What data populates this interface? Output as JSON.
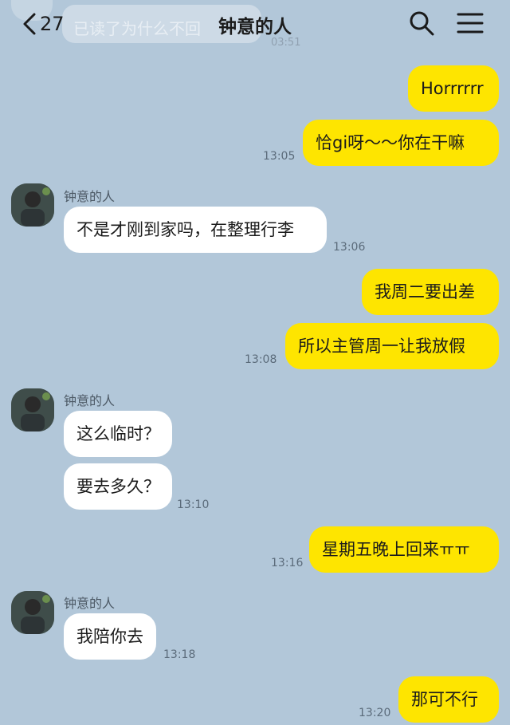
{
  "header": {
    "back_count": "27",
    "title": "钟意的人",
    "faded_preview": "已读了为什么不回",
    "faded_time": "03:51"
  },
  "contact": {
    "name": "钟意的人"
  },
  "messages": [
    {
      "text": "Horrrrrr",
      "sender": "me"
    },
    {
      "text": "恰gi呀～～你在干嘛",
      "sender": "me",
      "time": "13:05"
    },
    {
      "text": "不是才刚到家吗，在整理行李",
      "sender": "other",
      "time": "13:06"
    },
    {
      "text": "我周二要出差",
      "sender": "me"
    },
    {
      "text": "所以主管周一让我放假",
      "sender": "me",
      "time": "13:08"
    },
    {
      "text": "这么临时？",
      "sender": "other"
    },
    {
      "text": "要去多久？",
      "sender": "other",
      "time": "13:10"
    },
    {
      "text": "星期五晚上回来ㅠㅠ",
      "sender": "me",
      "time": "13:16"
    },
    {
      "text": "我陪你去",
      "sender": "other",
      "time": "13:18"
    },
    {
      "text": "那可不行",
      "sender": "me",
      "time": "13:20"
    }
  ],
  "colors": {
    "background": "#b2c7d9",
    "my_bubble": "#fee500",
    "their_bubble": "#ffffff"
  }
}
